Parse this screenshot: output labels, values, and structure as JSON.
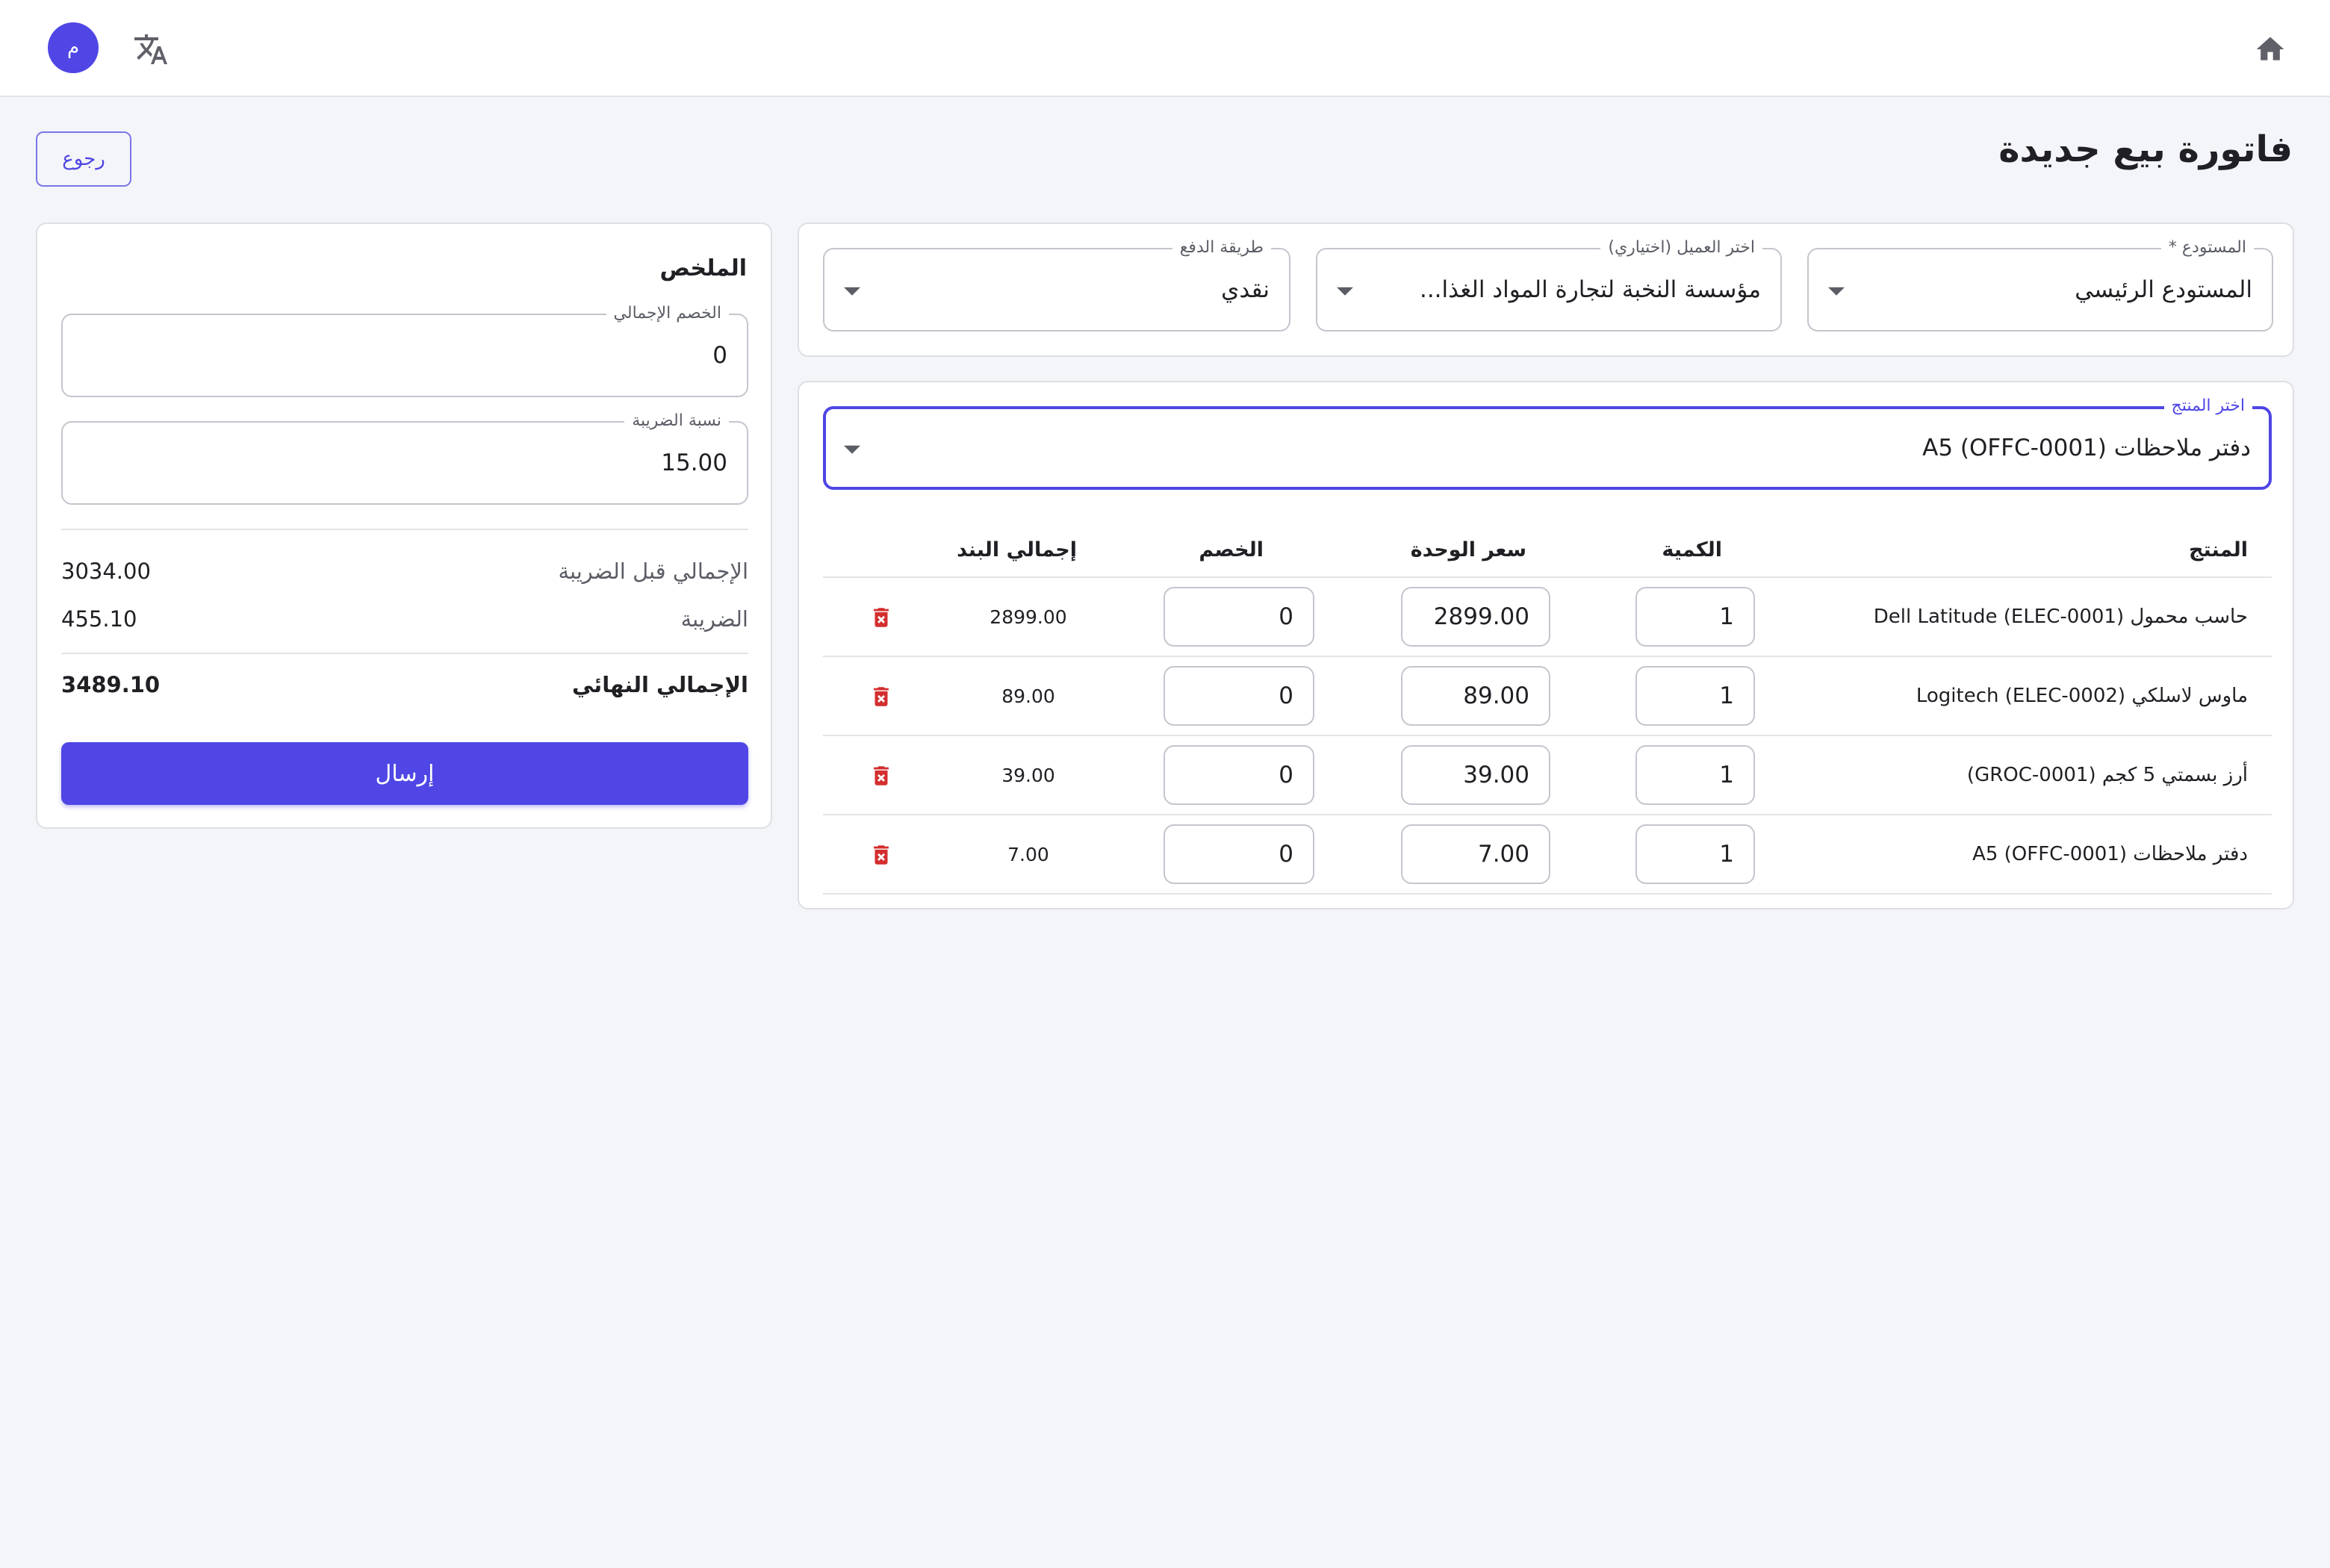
{
  "appbar": {
    "avatar_initial": "م",
    "icons": {
      "home": "home-icon",
      "translate": "translate-icon"
    }
  },
  "page": {
    "title": "فاتورة بيع جديدة",
    "back_label": "رجوع"
  },
  "header_fields": {
    "warehouse": {
      "label": "المستودع *",
      "value": "المستودع الرئيسي"
    },
    "customer": {
      "label": "اختر العميل (اختياري)",
      "value": "مؤسسة النخبة لتجارة المواد الغذا..."
    },
    "payment": {
      "label": "طريقة الدفع",
      "value": "نقدي"
    }
  },
  "product_picker": {
    "label": "اختر المنتج",
    "value": "دفتر ملاحظات A5 (OFFC-0001)"
  },
  "table": {
    "headers": {
      "product": "المنتج",
      "quantity": "الكمية",
      "unit_price": "سعر الوحدة",
      "discount": "الخصم",
      "line_total": "إجمالي البند"
    },
    "rows": [
      {
        "product": "حاسب محمول Dell Latitude (ELEC-0001)",
        "quantity": "1",
        "unit_price": "2899.00",
        "discount": "0",
        "line_total": "2899.00"
      },
      {
        "product": "ماوس لاسلكي Logitech (ELEC-0002)",
        "quantity": "1",
        "unit_price": "89.00",
        "discount": "0",
        "line_total": "89.00"
      },
      {
        "product": "أرز بسمتي 5 كجم (GROC-0001)",
        "quantity": "1",
        "unit_price": "39.00",
        "discount": "0",
        "line_total": "39.00"
      },
      {
        "product": "دفتر ملاحظات A5 (OFFC-0001)",
        "quantity": "1",
        "unit_price": "7.00",
        "discount": "0",
        "line_total": "7.00"
      }
    ]
  },
  "summary": {
    "title": "الملخص",
    "total_discount": {
      "label": "الخصم الإجمالي",
      "value": "0"
    },
    "tax_rate": {
      "label": "نسبة الضريبة",
      "value": "15.00"
    },
    "subtotal": {
      "label": "الإجمالي قبل الضريبة",
      "value": "3034.00"
    },
    "tax": {
      "label": "الضريبة",
      "value": "455.10"
    },
    "grand_total": {
      "label": "الإجمالي النهائي",
      "value": "3489.10"
    },
    "submit_label": "إرسال"
  },
  "colors": {
    "primary": "#4f46e5",
    "danger": "#d32f2f",
    "background": "#f4f5f8"
  }
}
